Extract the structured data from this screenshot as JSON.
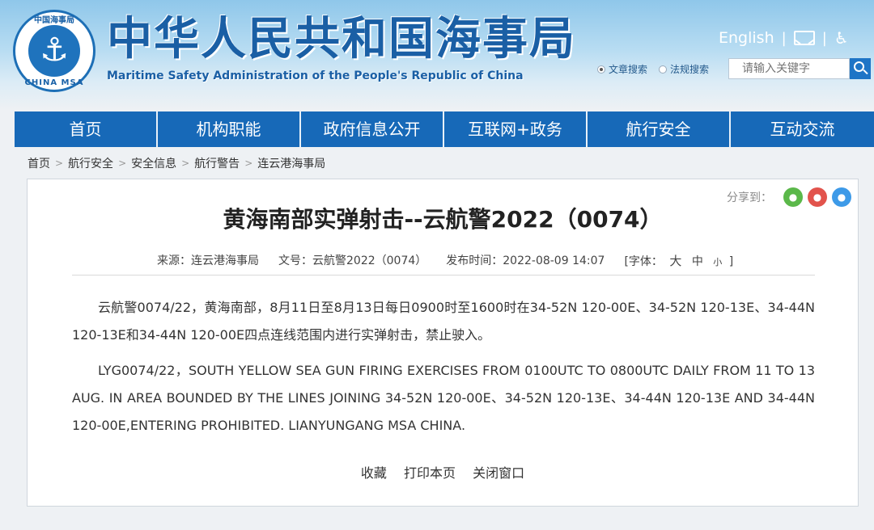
{
  "header": {
    "logo": {
      "top_text": "中国海事局",
      "bottom_text": "CHINA MSA",
      "icon": "anchor-icon"
    },
    "title_cn": "中华人民共和国海事局",
    "title_en": "Maritime Safety Administration of the People's Republic of China",
    "english_link": "English",
    "separator": "|",
    "mail_icon": "mail-icon",
    "accessibility_icon": "accessibility-icon",
    "accessibility_glyph": "♿"
  },
  "search": {
    "option_article": "文章搜索",
    "option_regulation": "法规搜索",
    "placeholder": "请输入关键字"
  },
  "nav": {
    "items": [
      "首页",
      "机构职能",
      "政府信息公开",
      "互联网+政务",
      "航行安全",
      "互动交流"
    ]
  },
  "breadcrumb": {
    "items": [
      "首页",
      "航行安全",
      "安全信息",
      "航行警告",
      "连云港海事局"
    ],
    "separator": ">"
  },
  "article": {
    "share_label": "分享到：",
    "share_icons": [
      "wechat-icon",
      "weibo-icon",
      "qq-icon"
    ],
    "title": "黄海南部实弹射击--云航警2022（0074）",
    "source": "来源：连云港海事局",
    "doc_no": "文号：云航警2022（0074）",
    "publish_time": "发布时间：2022-08-09 14:07",
    "font_label": "[字体：",
    "font_large": "大",
    "font_medium": "中",
    "font_small": "小",
    "font_close": "]",
    "para_cn": "云航警0074/22，黄海南部，8月11日至8月13日每日0900时至1600时在34-52N 120-00E、34-52N 120-13E、34-44N 120-13E和34-44N 120-00E四点连线范围内进行实弹射击，禁止驶入。",
    "para_en": "LYG0074/22，SOUTH YELLOW SEA GUN FIRING EXERCISES FROM 0100UTC TO 0800UTC DAILY FROM 11 TO 13 AUG. IN AREA BOUNDED BY THE LINES JOINING 34-52N 120-00E、34-52N 120-13E、34-44N 120-13E AND 34-44N 120-00E,ENTERING PROHIBITED. LIANYUNGANG MSA CHINA.",
    "actions": [
      "收藏",
      "打印本页",
      "关闭窗口"
    ]
  },
  "colors": {
    "brand_blue": "#1769b8",
    "title_blue": "#1a5fa5",
    "wechat": "#5bb84a",
    "weibo": "#e2534c",
    "qq": "#3d9ae8"
  }
}
